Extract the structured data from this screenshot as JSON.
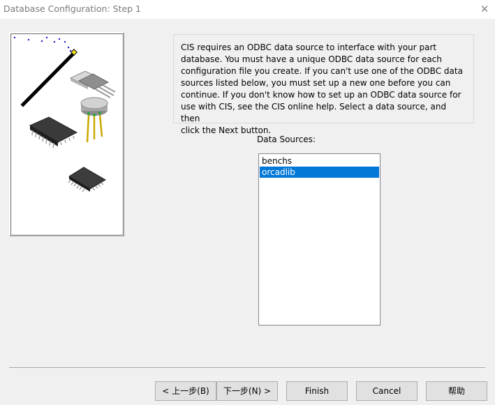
{
  "window": {
    "title": "Database Configuration: Step 1",
    "close_glyph": "✕"
  },
  "info": {
    "text": "CIS requires an ODBC data source to interface with your part\ndatabase. You must have a unique ODBC data source for each\nconfiguration file you create. If you can't use one of the ODBC data\nsources listed below, you must set up a new one before you can\ncontinue. If you don't know how to set up an ODBC data source for\nuse with CIS, see the CIS online help.  Select a data source, and then\nclick the Next button."
  },
  "data_sources": {
    "label": "Data Sources:",
    "items": [
      {
        "label": "benchs",
        "selected": false
      },
      {
        "label": "orcadlib",
        "selected": true
      }
    ],
    "selected_color": "#0078d7"
  },
  "buttons": {
    "back": "< 上一步(B)",
    "next": "下一步(N) >",
    "finish": "Finish",
    "cancel": "Cancel",
    "help": "帮助"
  },
  "illustration": {
    "icons": [
      "magic-wand-icon",
      "to220-chip-icon",
      "to5-can-transistor-icon",
      "dip-chip-icon",
      "soic-chip-icon"
    ]
  }
}
